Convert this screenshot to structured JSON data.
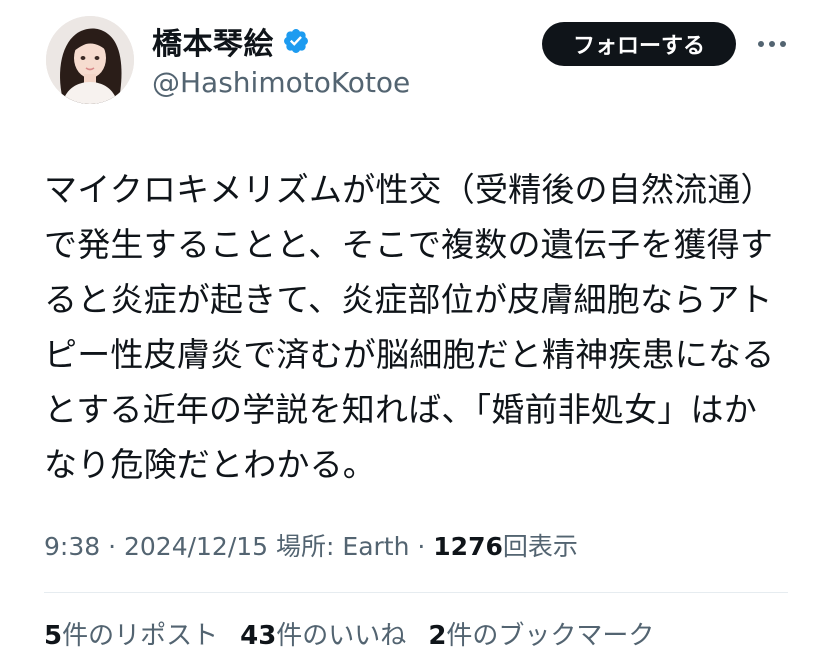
{
  "author": {
    "display_name": "橋本琴絵",
    "handle": "@HashimotoKotoe",
    "verified_icon": "verified-badge-icon",
    "verified_color": "#1d9bf0"
  },
  "actions": {
    "follow_label": "フォローする",
    "more_icon": "more-horizontal-icon"
  },
  "tweet": {
    "lines": [
      "マイクロキメリズムが性交（受精後の自然流通）",
      "で発生することと、そこで複数の遺伝子を獲得す",
      "ると炎症が起きて、炎症部位が皮膚細胞ならアト",
      "ピー性皮膚炎で済むが脳細胞だと精神疾患になる",
      "とする近年の学説を知れば、「婚前非処女」はか",
      "なり危険だとわかる。"
    ]
  },
  "meta": {
    "time": "9:38",
    "sep1": " · ",
    "date": "2024/12/15",
    "location": " 場所: Earth",
    "sep2": " · ",
    "views_count": "1276",
    "views_label": "回表示"
  },
  "stats": {
    "reposts_count": "5",
    "reposts_label": "件のリポスト",
    "likes_count": "43",
    "likes_label": "件のいいね",
    "bookmarks_count": "2",
    "bookmarks_label": "件のブックマーク"
  },
  "colors": {
    "text": "#0f1419",
    "secondary": "#536471",
    "follow_bg": "#0f1419",
    "divider": "#e6ecf0"
  }
}
